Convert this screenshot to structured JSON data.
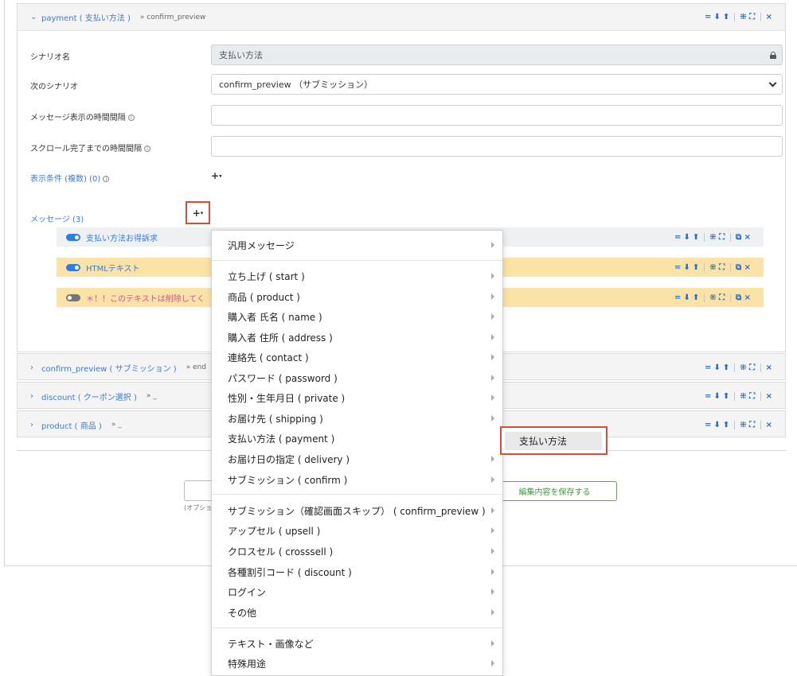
{
  "sections": {
    "payment": {
      "title": "payment ( 支払い方法 )",
      "next": "» confirm_preview",
      "controls": [
        "=",
        "⬇",
        "⬆",
        "⛶",
        "⛶",
        "×"
      ]
    },
    "confirm_preview": {
      "title": "confirm_preview ( サブミッション )",
      "next": "» end"
    },
    "discount": {
      "title": "discount ( クーポン選択 )",
      "next": "» _"
    },
    "product": {
      "title": "product ( 商品 )",
      "next": "» _"
    }
  },
  "form": {
    "scenario_name_label": "シナリオ名",
    "scenario_name_value": "支払い方法",
    "next_scenario_label": "次のシナリオ",
    "next_scenario_value": "confirm_preview （サブミッション）",
    "message_interval_label": "メッセージ表示の時間間隔",
    "scroll_interval_label": "スクロール完了までの時間間隔",
    "display_conditions_label": "表示条件 (複数) (0)",
    "messages_label": "メッセージ (3)",
    "plus_label": "+",
    "caret": "▾"
  },
  "messages": [
    {
      "label": "支払い方法お得訴求",
      "enabled": true
    },
    {
      "label": "HTMLテキスト",
      "enabled": true
    },
    {
      "label": "＊！！このテキストは削除してく",
      "enabled": false
    }
  ],
  "footer": {
    "optional_caption": "(オプショ",
    "save_label": "編集内容を保存する"
  },
  "dropdown": {
    "items": [
      {
        "label": "汎用メッセージ"
      },
      {
        "label": "立ち上げ ( start )"
      },
      {
        "label": "商品 ( product )"
      },
      {
        "label": "購入者 氏名 ( name )"
      },
      {
        "label": "購入者 住所 ( address )"
      },
      {
        "label": "連絡先 ( contact )"
      },
      {
        "label": "パスワード ( password )"
      },
      {
        "label": "性別・生年月日 ( private )"
      },
      {
        "label": "お届け先 ( shipping )"
      },
      {
        "label": "支払い方法 ( payment )"
      },
      {
        "label": "お届け日の指定 ( delivery )"
      },
      {
        "label": "サブミッション ( confirm )"
      },
      {
        "label": "サブミッション（確認画面スキップ） ( confirm_preview )"
      },
      {
        "label": "アップセル ( upsell )"
      },
      {
        "label": "クロスセル ( crosssell )"
      },
      {
        "label": "各種割引コード ( discount )"
      },
      {
        "label": "ログイン"
      },
      {
        "label": "その他"
      },
      {
        "label": "テキスト・画像など"
      },
      {
        "label": "特殊用途"
      }
    ],
    "submenu_item": "支払い方法"
  },
  "colors": {
    "accent": "#3a7bd5",
    "highlight_border": "#d94b3a",
    "save_green": "#3e9a3e",
    "message_yellow": "#fbe3a8"
  }
}
